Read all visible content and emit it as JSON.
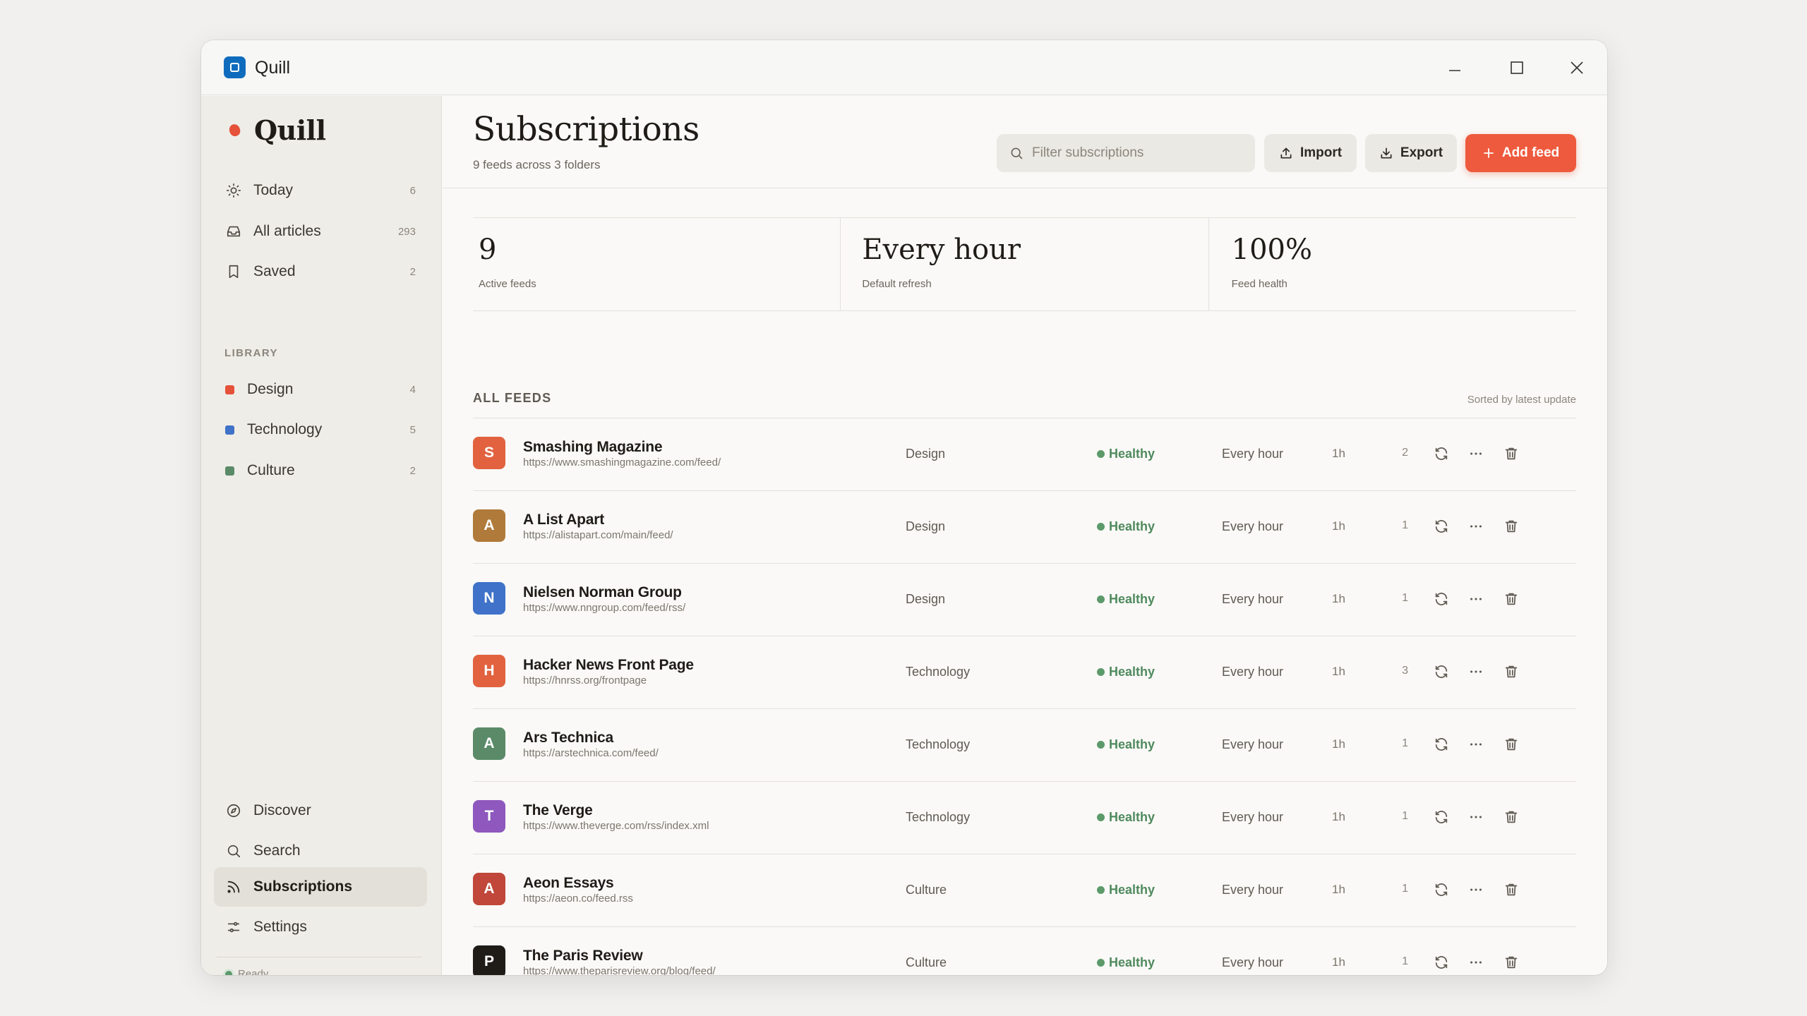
{
  "window": {
    "title": "Quill"
  },
  "sidebar": {
    "brand": "Quill",
    "primary": [
      {
        "label": "Today",
        "count": "6",
        "icon": "sun-icon"
      },
      {
        "label": "All articles",
        "count": "293",
        "icon": "inbox-icon"
      },
      {
        "label": "Saved",
        "count": "2",
        "icon": "bookmark-icon"
      }
    ],
    "library_label": "LIBRARY",
    "folders": [
      {
        "label": "Design",
        "count": "4",
        "color": "#e55239"
      },
      {
        "label": "Technology",
        "count": "5",
        "color": "#3f72c8"
      },
      {
        "label": "Culture",
        "count": "2",
        "color": "#5a8a68"
      }
    ],
    "bottom": [
      {
        "label": "Discover",
        "icon": "compass-icon"
      },
      {
        "label": "Search",
        "icon": "search-icon"
      },
      {
        "label": "Subscriptions",
        "icon": "rss-icon",
        "active": true
      },
      {
        "label": "Settings",
        "icon": "sliders-icon"
      }
    ],
    "status": "Ready"
  },
  "header": {
    "title": "Subscriptions",
    "subtitle": "9 feeds across 3 folders",
    "search_placeholder": "Filter subscriptions",
    "import_label": "Import",
    "export_label": "Export",
    "add_label": "Add feed"
  },
  "stats": [
    {
      "value": "9",
      "label": "Active feeds"
    },
    {
      "value": "Every hour",
      "label": "Default refresh"
    },
    {
      "value": "100%",
      "label": "Feed health"
    }
  ],
  "list": {
    "title": "ALL FEEDS",
    "sort": "Sorted by latest update",
    "feeds": [
      {
        "initial": "S",
        "color": "#e2623f",
        "name": "Smashing Magazine",
        "url": "https://www.smashingmagazine.com/feed/",
        "folder": "Design",
        "health": "Healthy",
        "refresh": "Every hour",
        "age": "1h",
        "count": "2"
      },
      {
        "initial": "A",
        "color": "#b07a3a",
        "name": "A List Apart",
        "url": "https://alistapart.com/main/feed/",
        "folder": "Design",
        "health": "Healthy",
        "refresh": "Every hour",
        "age": "1h",
        "count": "1"
      },
      {
        "initial": "N",
        "color": "#3f72c8",
        "name": "Nielsen Norman Group",
        "url": "https://www.nngroup.com/feed/rss/",
        "folder": "Design",
        "health": "Healthy",
        "refresh": "Every hour",
        "age": "1h",
        "count": "1"
      },
      {
        "initial": "H",
        "color": "#e2623f",
        "name": "Hacker News Front Page",
        "url": "https://hnrss.org/frontpage",
        "folder": "Technology",
        "health": "Healthy",
        "refresh": "Every hour",
        "age": "1h",
        "count": "3"
      },
      {
        "initial": "A",
        "color": "#5a8a68",
        "name": "Ars Technica",
        "url": "https://arstechnica.com/feed/",
        "folder": "Technology",
        "health": "Healthy",
        "refresh": "Every hour",
        "age": "1h",
        "count": "1"
      },
      {
        "initial": "T",
        "color": "#8e58be",
        "name": "The Verge",
        "url": "https://www.theverge.com/rss/index.xml",
        "folder": "Technology",
        "health": "Healthy",
        "refresh": "Every hour",
        "age": "1h",
        "count": "1"
      },
      {
        "initial": "A",
        "color": "#c0473a",
        "name": "Aeon Essays",
        "url": "https://aeon.co/feed.rss",
        "folder": "Culture",
        "health": "Healthy",
        "refresh": "Every hour",
        "age": "1h",
        "count": "1"
      },
      {
        "initial": "P",
        "color": "#1f1c18",
        "name": "The Paris Review",
        "url": "https://www.theparisreview.org/blog/feed/",
        "folder": "Culture",
        "health": "Healthy",
        "refresh": "Every hour",
        "age": "1h",
        "count": "1"
      }
    ]
  }
}
